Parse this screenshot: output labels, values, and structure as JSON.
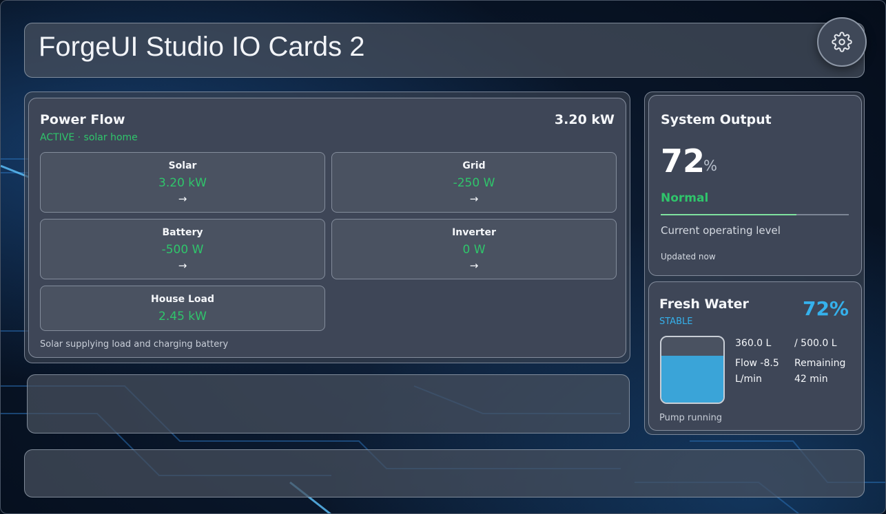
{
  "header": {
    "title": "ForgeUI Studio IO Cards 2",
    "settings_icon": "gear-icon"
  },
  "power_flow": {
    "title": "Power Flow",
    "total": "3.20 kW",
    "status": "ACTIVE · solar home",
    "nodes": [
      {
        "label": "Solar",
        "value": "3.20 kW",
        "arrow": "→"
      },
      {
        "label": "Grid",
        "value": "-250 W",
        "arrow": "→"
      },
      {
        "label": "Battery",
        "value": "-500 W",
        "arrow": "→"
      },
      {
        "label": "Inverter",
        "value": "0 W",
        "arrow": "→"
      },
      {
        "label": "House Load",
        "value": "2.45 kW"
      }
    ],
    "footer": "Solar supplying load and charging battery"
  },
  "system_output": {
    "title": "System Output",
    "value": "72",
    "unit": "%",
    "state": "Normal",
    "level": 0.72,
    "caption": "Current operating level",
    "updated": "Updated now"
  },
  "fresh_water": {
    "title": "Fresh Water",
    "percent": "72%",
    "status": "STABLE",
    "level": 0.72,
    "volume": "360.0 L",
    "capacity": "/ 500.0 L",
    "flow": "Flow -8.5 L/min",
    "remaining": "Remaining 42 min",
    "footer": "Pump running"
  },
  "colors": {
    "accent_green": "#2fc56b",
    "accent_blue": "#35b1ec",
    "panel": "#3e4657"
  }
}
